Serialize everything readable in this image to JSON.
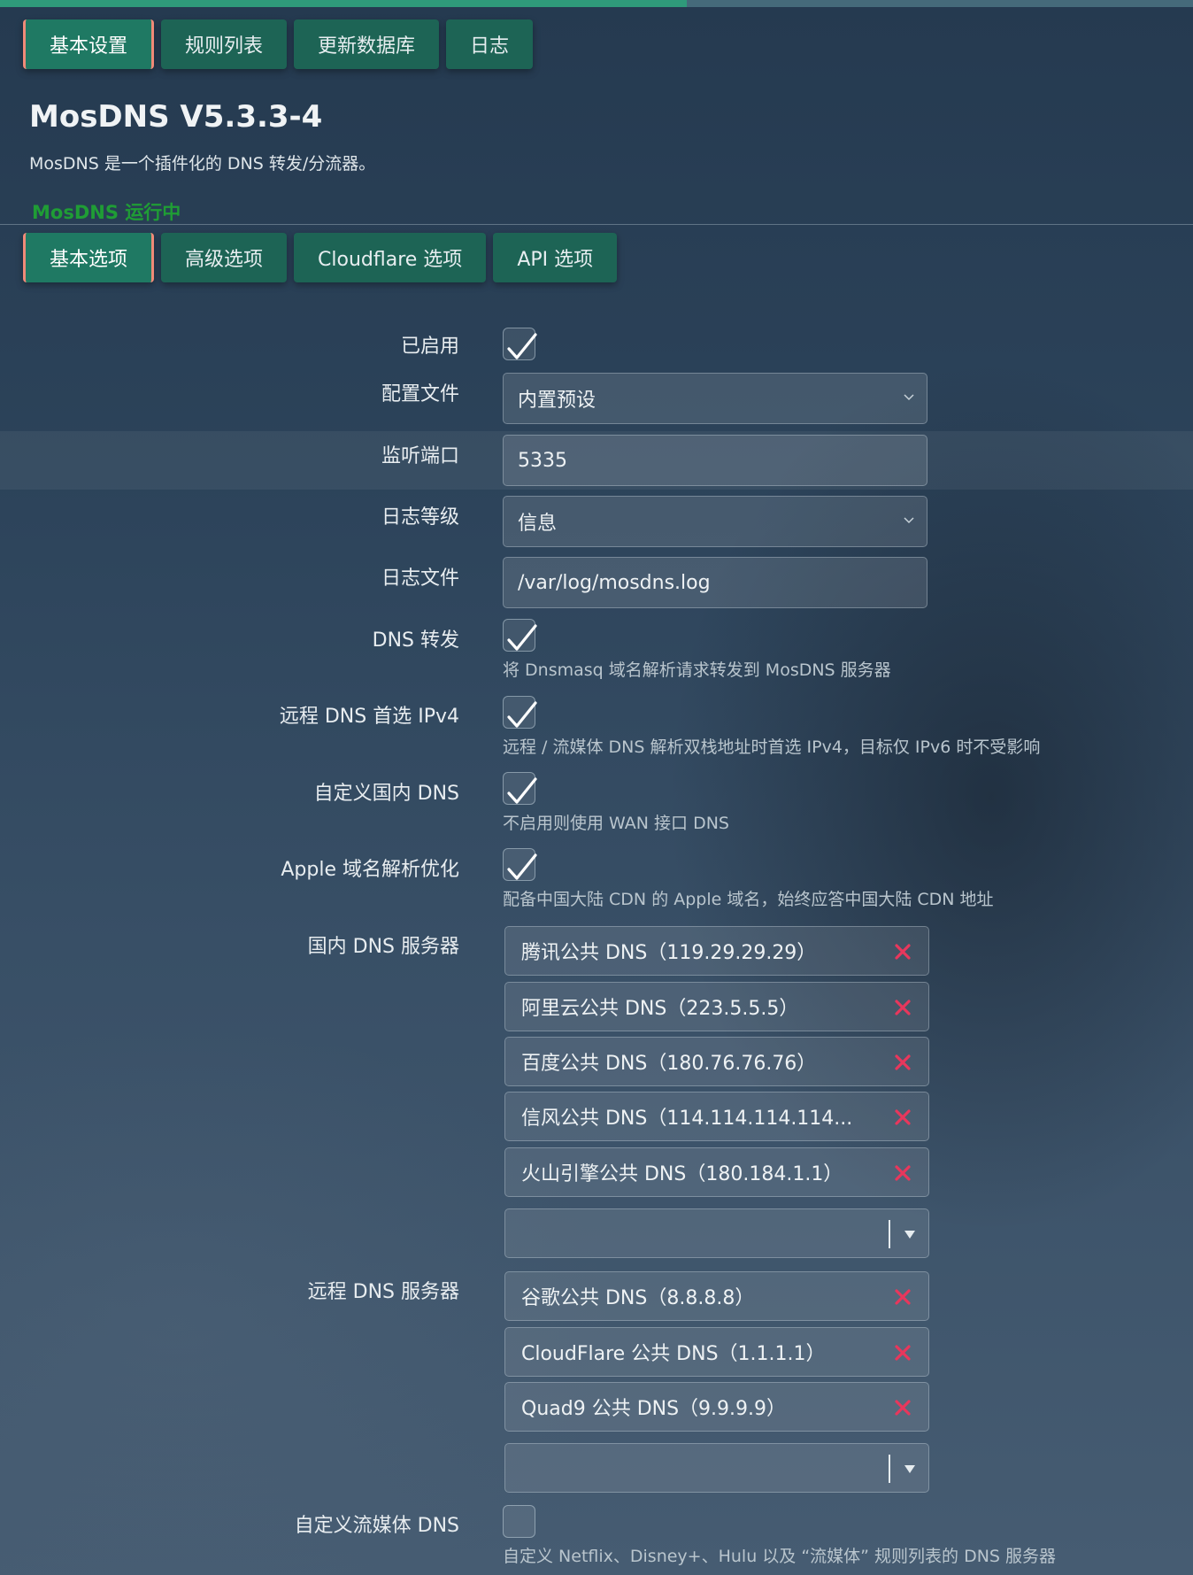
{
  "colors": {
    "accent": "#1f7963",
    "tab_border": "#f08a78",
    "status_running": "#1f9d35",
    "remove_x": "#e8375c"
  },
  "top_tabs": [
    {
      "label": "基本设置",
      "active": true
    },
    {
      "label": "规则列表",
      "active": false
    },
    {
      "label": "更新数据库",
      "active": false
    },
    {
      "label": "日志",
      "active": false
    }
  ],
  "header": {
    "title": "MosDNS V5.3.3-4",
    "description": "MosDNS 是一个插件化的 DNS 转发/分流器。",
    "status": "MosDNS 运行中"
  },
  "section_tabs": [
    {
      "label": "基本选项",
      "active": true
    },
    {
      "label": "高级选项",
      "active": false
    },
    {
      "label": "Cloudflare 选项",
      "active": false
    },
    {
      "label": "API 选项",
      "active": false
    }
  ],
  "form": {
    "enabled": {
      "label": "已启用",
      "checked": true
    },
    "config_file": {
      "label": "配置文件",
      "value": "内置预设"
    },
    "listen_port": {
      "label": "监听端口",
      "value": "5335"
    },
    "log_level": {
      "label": "日志等级",
      "value": "信息"
    },
    "log_file": {
      "label": "日志文件",
      "value": "/var/log/mosdns.log"
    },
    "dns_forward": {
      "label": "DNS 转发",
      "checked": true,
      "help": "将 Dnsmasq 域名解析请求转发到 MosDNS 服务器"
    },
    "prefer_ipv4": {
      "label": "远程 DNS 首选 IPv4",
      "checked": true,
      "help": "远程 / 流媒体 DNS 解析双栈地址时首选 IPv4，目标仅 IPv6 时不受影响"
    },
    "custom_local_dns": {
      "label": "自定义国内 DNS",
      "checked": true,
      "help": "不启用则使用 WAN 接口 DNS"
    },
    "apple_optimize": {
      "label": "Apple 域名解析优化",
      "checked": true,
      "help": "配备中国大陆 CDN 的 Apple 域名，始终应答中国大陆 CDN 地址"
    },
    "local_dns": {
      "label": "国内 DNS 服务器",
      "items": [
        "腾讯公共 DNS（119.29.29.29）",
        "阿里云公共 DNS（223.5.5.5）",
        "百度公共 DNS（180.76.76.76）",
        "信风公共 DNS（114.114.114.114...",
        "火山引擎公共 DNS（180.184.1.1）"
      ]
    },
    "remote_dns": {
      "label": "远程 DNS 服务器",
      "items": [
        "谷歌公共 DNS（8.8.8.8）",
        "CloudFlare 公共 DNS（1.1.1.1）",
        "Quad9 公共 DNS（9.9.9.9）"
      ]
    },
    "custom_stream_dns": {
      "label": "自定义流媒体 DNS",
      "checked": false,
      "help": "自定义 Netflix、Disney+、Hulu 以及 “流媒体” 规则列表的 DNS 服务器"
    }
  }
}
